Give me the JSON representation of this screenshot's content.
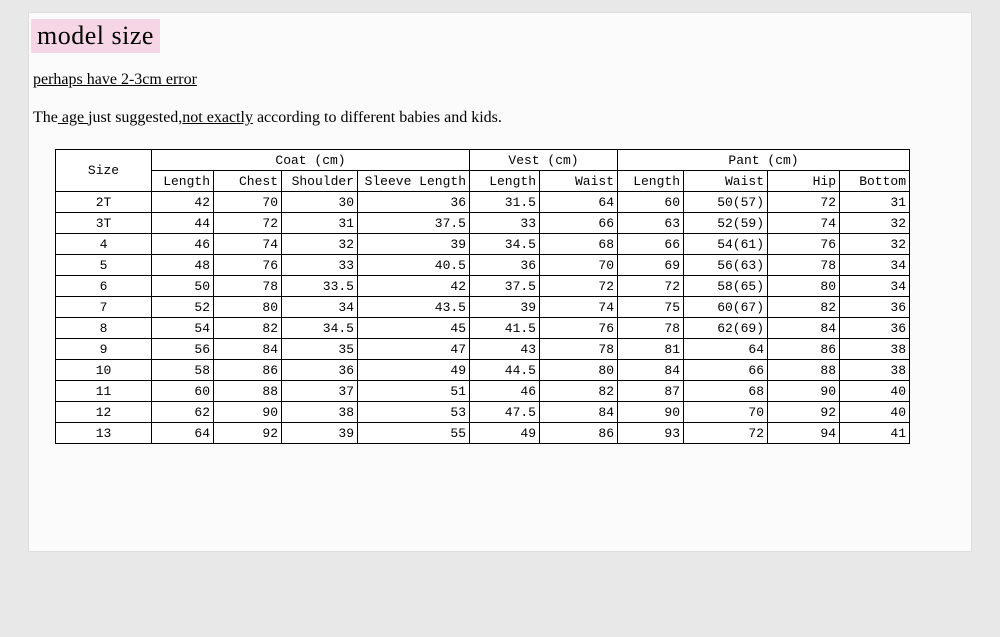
{
  "title": "model size",
  "note1": "perhaps have 2-3cm error",
  "note2_pre": "The",
  "note2_age": " age ",
  "note2_mid": "just suggested,",
  "note2_not": "not exactly",
  "note2_post": " according to different babies and kids.",
  "headers": {
    "size": "Size",
    "groups": {
      "coat": "Coat (cm)",
      "vest": "Vest (cm)",
      "pant": "Pant (cm)"
    },
    "coat": {
      "length": "Length",
      "chest": "Chest",
      "shoulder": "Shoulder",
      "sleeve": "Sleeve Length"
    },
    "vest": {
      "length": "Length",
      "waist": "Waist"
    },
    "pant": {
      "length": "Length",
      "waist": "Waist",
      "hip": "Hip",
      "bottom": "Bottom"
    }
  },
  "rows": [
    {
      "size": "2T",
      "coat": [
        "42",
        "70",
        "30",
        "36"
      ],
      "vest": [
        "31.5",
        "64"
      ],
      "pant": [
        "60",
        "50(57)",
        "72",
        "31"
      ]
    },
    {
      "size": "3T",
      "coat": [
        "44",
        "72",
        "31",
        "37.5"
      ],
      "vest": [
        "33",
        "66"
      ],
      "pant": [
        "63",
        "52(59)",
        "74",
        "32"
      ]
    },
    {
      "size": "4",
      "coat": [
        "46",
        "74",
        "32",
        "39"
      ],
      "vest": [
        "34.5",
        "68"
      ],
      "pant": [
        "66",
        "54(61)",
        "76",
        "32"
      ]
    },
    {
      "size": "5",
      "coat": [
        "48",
        "76",
        "33",
        "40.5"
      ],
      "vest": [
        "36",
        "70"
      ],
      "pant": [
        "69",
        "56(63)",
        "78",
        "34"
      ]
    },
    {
      "size": "6",
      "coat": [
        "50",
        "78",
        "33.5",
        "42"
      ],
      "vest": [
        "37.5",
        "72"
      ],
      "pant": [
        "72",
        "58(65)",
        "80",
        "34"
      ]
    },
    {
      "size": "7",
      "coat": [
        "52",
        "80",
        "34",
        "43.5"
      ],
      "vest": [
        "39",
        "74"
      ],
      "pant": [
        "75",
        "60(67)",
        "82",
        "36"
      ]
    },
    {
      "size": "8",
      "coat": [
        "54",
        "82",
        "34.5",
        "45"
      ],
      "vest": [
        "41.5",
        "76"
      ],
      "pant": [
        "78",
        "62(69)",
        "84",
        "36"
      ]
    },
    {
      "size": "9",
      "coat": [
        "56",
        "84",
        "35",
        "47"
      ],
      "vest": [
        "43",
        "78"
      ],
      "pant": [
        "81",
        "64",
        "86",
        "38"
      ]
    },
    {
      "size": "10",
      "coat": [
        "58",
        "86",
        "36",
        "49"
      ],
      "vest": [
        "44.5",
        "80"
      ],
      "pant": [
        "84",
        "66",
        "88",
        "38"
      ]
    },
    {
      "size": "11",
      "coat": [
        "60",
        "88",
        "37",
        "51"
      ],
      "vest": [
        "46",
        "82"
      ],
      "pant": [
        "87",
        "68",
        "90",
        "40"
      ]
    },
    {
      "size": "12",
      "coat": [
        "62",
        "90",
        "38",
        "53"
      ],
      "vest": [
        "47.5",
        "84"
      ],
      "pant": [
        "90",
        "70",
        "92",
        "40"
      ]
    },
    {
      "size": "13",
      "coat": [
        "64",
        "92",
        "39",
        "55"
      ],
      "vest": [
        "49",
        "86"
      ],
      "pant": [
        "93",
        "72",
        "94",
        "41"
      ]
    }
  ]
}
